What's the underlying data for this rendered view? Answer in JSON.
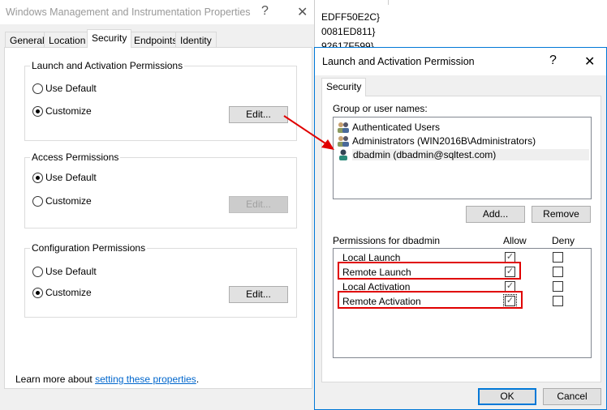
{
  "background": {
    "lines": [
      "EDFF50E2C}",
      "0081ED811}",
      "92617F599}"
    ]
  },
  "props": {
    "title": "Windows Management and Instrumentation Properties",
    "help": "?",
    "close": "✕",
    "tabs": [
      "General",
      "Location",
      "Security",
      "Endpoints",
      "Identity"
    ],
    "active_tab": "Security",
    "groups": [
      {
        "label": "Launch and Activation Permissions",
        "options": [
          "Use Default",
          "Customize"
        ],
        "selected": "Customize",
        "edit": "Edit...",
        "edit_enabled": true
      },
      {
        "label": "Access Permissions",
        "options": [
          "Use Default",
          "Customize"
        ],
        "selected": "Use Default",
        "edit": "Edit...",
        "edit_enabled": false
      },
      {
        "label": "Configuration Permissions",
        "options": [
          "Use Default",
          "Customize"
        ],
        "selected": "Customize",
        "edit": "Edit...",
        "edit_enabled": true
      }
    ],
    "learn_prefix": "Learn more about ",
    "learn_link": "setting these properties",
    "learn_suffix": "."
  },
  "perm": {
    "title": "Launch and Activation Permission",
    "help": "?",
    "close": "✕",
    "tab": "Security",
    "group_label": "Group or user names:",
    "users": [
      {
        "name": "Authenticated Users",
        "icon": "group-icon"
      },
      {
        "name": "Administrators (WIN2016B\\Administrators)",
        "icon": "group-icon"
      },
      {
        "name": "dbadmin (dbadmin@sqltest.com)",
        "icon": "user-icon",
        "selected": true
      }
    ],
    "add": "Add...",
    "remove": "Remove",
    "perm_label": "Permissions for dbadmin",
    "allow": "Allow",
    "deny": "Deny",
    "permissions": [
      {
        "name": "Local Launch",
        "allow": true,
        "deny": false,
        "highlighted": false
      },
      {
        "name": "Remote Launch",
        "allow": true,
        "deny": false,
        "highlighted": true
      },
      {
        "name": "Local Activation",
        "allow": true,
        "deny": false,
        "highlighted": false
      },
      {
        "name": "Remote Activation",
        "allow": true,
        "deny": false,
        "highlighted": true
      }
    ],
    "ok": "OK",
    "cancel": "Cancel"
  },
  "colors": {
    "accent": "#0078d7",
    "highlight": "#e00000",
    "link": "#0066cc"
  }
}
